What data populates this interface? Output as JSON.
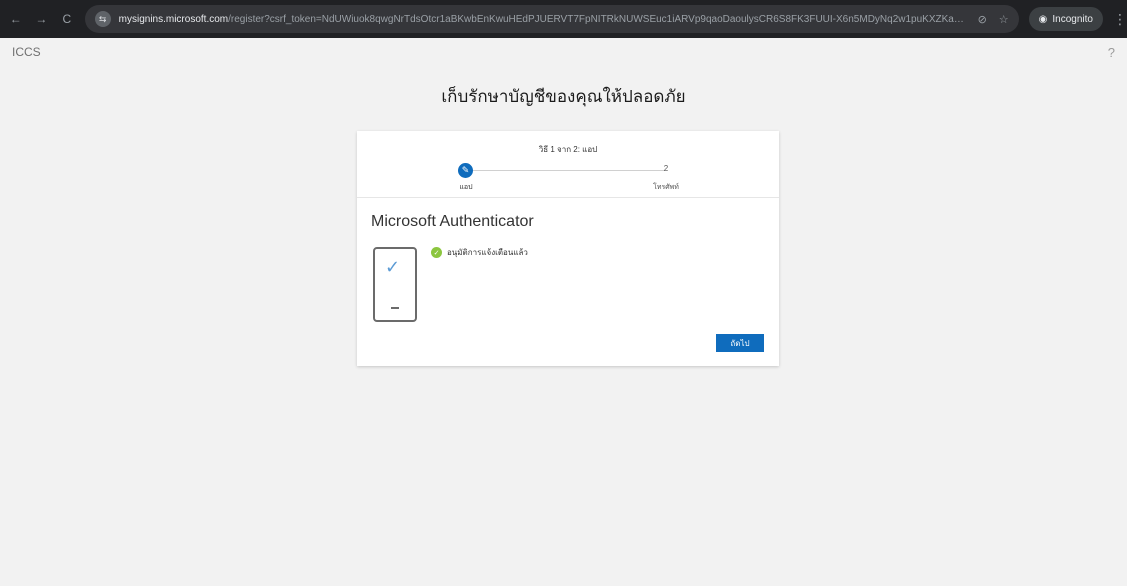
{
  "browser": {
    "url_host": "mysignins.microsoft.com",
    "url_rest": "/register?csrf_token=NdUWiuok8qwgNrTdsOtcr1aBKwbEnKwuHEdPJUERVT7FpNITRkNUWSEuc1iARVp9qaoDaoulysCR6S8FK3FUUI-X6n5MDyNq2w1puKXZKaKhBDmp8RGCgwgeFqEwAwC2Aw5K3aYlrNDoTlHsBroaWQ28izO...",
    "incognito_label": "Incognito"
  },
  "header": {
    "org": "ICCS",
    "help": "?"
  },
  "page_title": "เก็บรักษาบัญชีของคุณให้ปลอดภัย",
  "wizard": {
    "step_counter": "วิธี 1 จาก 2: แอป",
    "step1_label": "แอป",
    "step2_number": "2",
    "step2_label": "โทรศัพท์"
  },
  "method": {
    "title": "Microsoft Authenticator",
    "status_text": "อนุมัติการแจ้งเตือนแล้ว"
  },
  "buttons": {
    "next": "ถัดไป"
  },
  "colors": {
    "accent": "#0f6cbd",
    "success": "#8cc63f"
  },
  "icons": {
    "back": "←",
    "forward": "→",
    "reload": "C",
    "step1": "✎",
    "phone_check": "✓",
    "status_check": "✓"
  }
}
